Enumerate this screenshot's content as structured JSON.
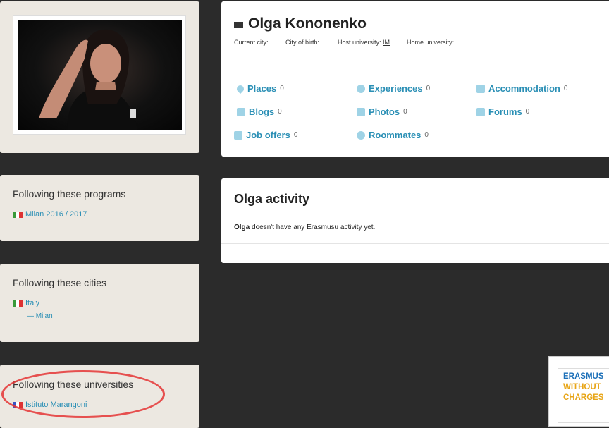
{
  "profile": {
    "name": "Olga Kononenko",
    "current_city_label": "Current city:",
    "city_of_birth_label": "City of birth:",
    "host_university_label": "Host university:",
    "host_university_value": "IM",
    "home_university_label": "Home university:"
  },
  "stats": [
    {
      "label": "Places",
      "count": "0",
      "icon": "map-pin-icon"
    },
    {
      "label": "Experiences",
      "count": "0",
      "icon": "info-icon"
    },
    {
      "label": "Accommodation",
      "count": "0",
      "icon": "building-icon"
    },
    {
      "label": "Blogs",
      "count": "0",
      "icon": "blog-icon"
    },
    {
      "label": "Photos",
      "count": "0",
      "icon": "photo-icon"
    },
    {
      "label": "Forums",
      "count": "0",
      "icon": "forum-icon"
    },
    {
      "label": "Job offers",
      "count": "0",
      "icon": "briefcase-icon"
    },
    {
      "label": "Roommates",
      "count": "0",
      "icon": "people-icon"
    }
  ],
  "programs": {
    "title": "Following these programs",
    "items": [
      "Milan 2016 / 2017"
    ]
  },
  "cities": {
    "title": "Following these cities",
    "country": "Italy",
    "city": "— Milan"
  },
  "universities": {
    "title": "Following these universities",
    "items": [
      "Istituto Marangoni"
    ]
  },
  "activity": {
    "title": "Olga activity",
    "name": "Olga",
    "text": " doesn't have any Erasmusu activity yet."
  },
  "ad": {
    "line1": "ERASMUS",
    "line2": "WITHOUT",
    "line3": "CHARGES"
  },
  "colors": {
    "link": "#2a8fb5",
    "background": "#2b2b2b",
    "side_card": "#ece8e1",
    "annotation": "#e53535"
  }
}
